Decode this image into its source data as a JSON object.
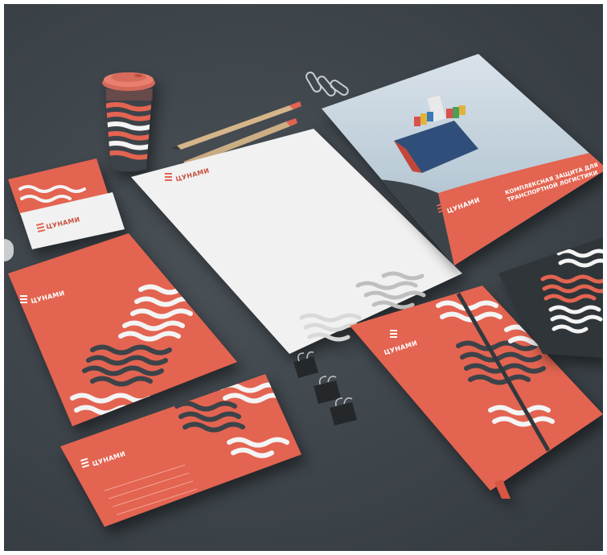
{
  "brand": {
    "name": "ЦУНАМИ",
    "tagline": "",
    "accent": "#e36451",
    "dark": "#3c4349",
    "paper": "#f2f2f2"
  },
  "brochure": {
    "headline_line1": "КОМПЛЕКСНАЯ ЗАЩИТА ДЛЯ",
    "headline_line2": "ТРАНСПОРТНОЙ ЛОГИСТИКИ",
    "subtext": ""
  },
  "icons": {
    "logo": "stacked-waves-logo-icon",
    "pattern": "wave-stripes-pattern"
  }
}
